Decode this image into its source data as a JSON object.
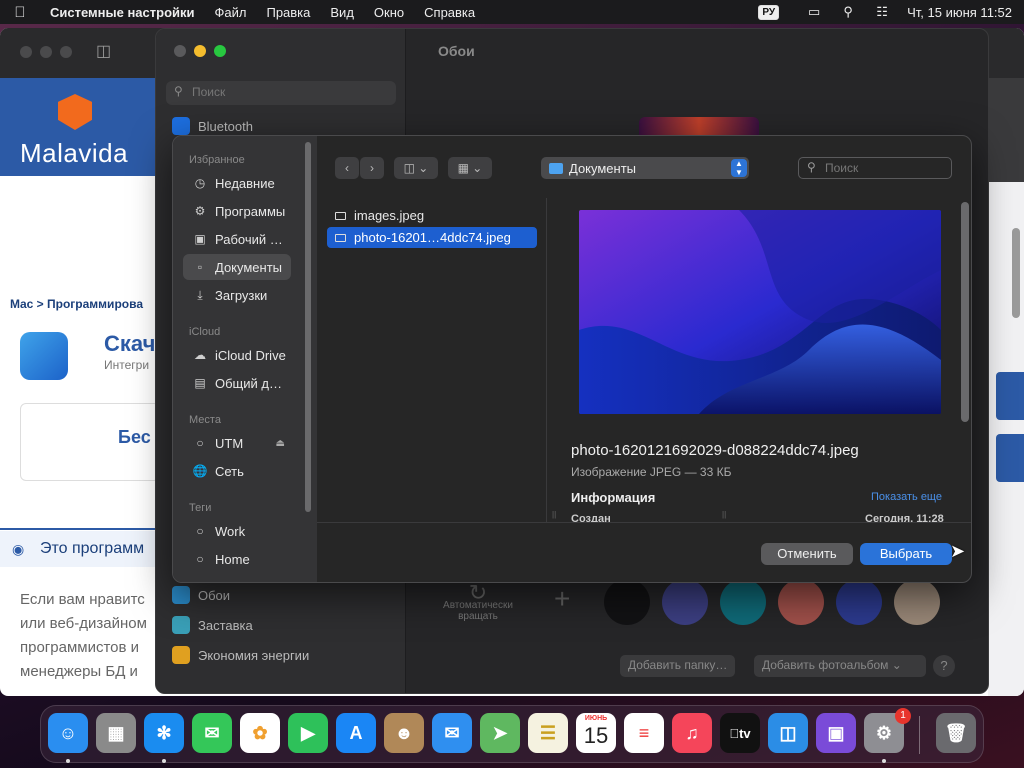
{
  "menubar": {
    "app": "Системные настройки",
    "items": [
      "Файл",
      "Правка",
      "Вид",
      "Окно",
      "Справка"
    ],
    "input_lang": "РУ",
    "clock": "Чт, 15 июня  11:52",
    "icons": [
      "apple-icon",
      "screen-mirroring-icon",
      "search-icon",
      "control-center-icon"
    ]
  },
  "browser": {
    "site_logo": "Malavida",
    "breadcrumb": "Mac > Программирова",
    "title": "Скач",
    "subtitle": "Интегри",
    "free_label": "Бес",
    "section_title": "Это программ",
    "body_lines": [
      "Если вам нравитс",
      "или веб-дизайном",
      "программистов и",
      "менеджеры БД и"
    ]
  },
  "settings": {
    "window_title": "Обои",
    "search_placeholder": "Поиск",
    "sidebar_top": "Bluetooth",
    "sidebar_bottom": [
      "Обои",
      "Заставка",
      "Экономия энергии"
    ],
    "auto_rotate_label": "Автоматически вращать",
    "add_folder": "Добавить папку…",
    "add_album": "Добавить фотоальбом",
    "help": "?",
    "swatch_colors": [
      "#121214",
      "#3c3f82",
      "#0f6a78",
      "#a0504a",
      "#2c3a8e",
      "#9a8878"
    ]
  },
  "panel": {
    "sidebar": {
      "favorites_header": "Избранное",
      "favorites": [
        {
          "label": "Недавние",
          "icon": "clock-icon"
        },
        {
          "label": "Программы",
          "icon": "apps-icon"
        },
        {
          "label": "Рабочий стол",
          "icon": "desktop-icon"
        },
        {
          "label": "Документы",
          "icon": "document-icon",
          "selected": true
        },
        {
          "label": "Загрузки",
          "icon": "download-icon"
        }
      ],
      "icloud_header": "iCloud",
      "icloud": [
        {
          "label": "iCloud Drive",
          "icon": "cloud-icon"
        },
        {
          "label": "Общий доступ",
          "icon": "shared-folder-icon"
        }
      ],
      "places_header": "Места",
      "places": [
        {
          "label": "UTM",
          "icon": "disk-icon"
        },
        {
          "label": "Сеть",
          "icon": "globe-icon"
        }
      ],
      "tags_header": "Теги",
      "tags": [
        {
          "label": "Work",
          "icon": "tag-circle-icon"
        },
        {
          "label": "Home",
          "icon": "tag-circle-icon"
        }
      ]
    },
    "toolbar": {
      "location": "Документы",
      "search_placeholder": "Поиск"
    },
    "files": [
      {
        "name": "images.jpeg",
        "selected": false
      },
      {
        "name": "photo-16201…4ddc74.jpeg",
        "selected": true
      }
    ],
    "preview": {
      "filename": "photo-1620121692029-d088224ddc74.jpeg",
      "kind": "Изображение JPEG — 33 КБ",
      "info_title": "Информация",
      "show_more": "Показать еще",
      "created_label": "Создан",
      "created_value": "Сегодня, 11:28"
    },
    "cancel": "Отменить",
    "choose": "Выбрать"
  },
  "dock": {
    "calendar_month": "ИЮНЬ",
    "calendar_day": "15",
    "settings_badge": "1",
    "apps": [
      {
        "name": "Finder",
        "icon": "finder-icon",
        "color": "#2a8ef0"
      },
      {
        "name": "Launchpad",
        "icon": "launchpad-icon",
        "color": "#8a8a8a"
      },
      {
        "name": "Safari",
        "icon": "safari-icon",
        "color": "#1a8cf0"
      },
      {
        "name": "Messages",
        "icon": "messages-icon",
        "color": "#34c759"
      },
      {
        "name": "Photos",
        "icon": "photos-icon",
        "color": "#f0a030"
      },
      {
        "name": "FaceTime",
        "icon": "facetime-icon",
        "color": "#2ec15a"
      },
      {
        "name": "App Store",
        "icon": "app-store-icon",
        "color": "#1a86f5"
      },
      {
        "name": "Contacts",
        "icon": "contacts-icon",
        "color": "#b08858"
      },
      {
        "name": "Mail",
        "icon": "mail-icon",
        "color": "#2f8ff0"
      },
      {
        "name": "Maps",
        "icon": "maps-icon",
        "color": "#5fb860"
      },
      {
        "name": "Notes",
        "icon": "notes-icon",
        "color": "#f5d34a"
      },
      {
        "name": "Calendar",
        "icon": "calendar-icon",
        "color": "#ffffff"
      },
      {
        "name": "Reminders",
        "icon": "reminders-icon",
        "color": "#ffffff"
      },
      {
        "name": "Music",
        "icon": "music-icon",
        "color": "#f5455a"
      },
      {
        "name": "TV",
        "icon": "tv-icon",
        "color": "#111111"
      },
      {
        "name": "Keynote",
        "icon": "keynote-icon",
        "color": "#2b8de6"
      },
      {
        "name": "Xcode-like",
        "icon": "podcast-icon",
        "color": "#7a4bd8"
      },
      {
        "name": "System Settings",
        "icon": "settings-gear-icon",
        "color": "#8e8e93"
      },
      {
        "name": "Trash",
        "icon": "trash-icon",
        "color": "#6a6a6e"
      }
    ]
  }
}
